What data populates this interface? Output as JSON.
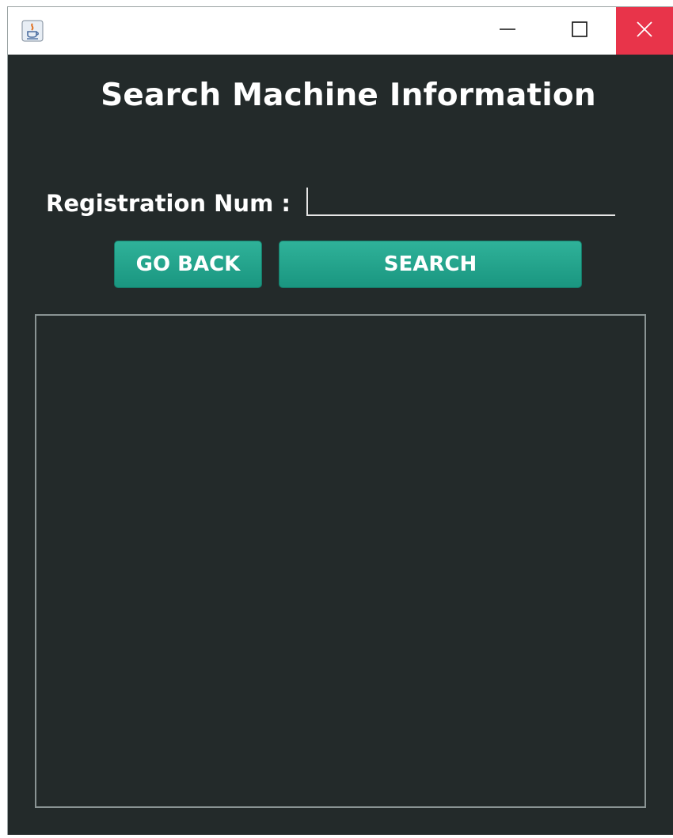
{
  "window": {
    "title": "",
    "controls": {
      "minimize_icon": "minimize-icon",
      "maximize_icon": "maximize-icon",
      "close_icon": "close-icon"
    },
    "colors": {
      "background": "#232a2a",
      "close_button": "#e8344a",
      "accent_button": "#1fa48b"
    }
  },
  "form": {
    "heading": "Search Machine Information",
    "registration_label": "Registration Num :",
    "registration_value": "",
    "registration_placeholder": ""
  },
  "buttons": {
    "go_back_label": "GO BACK",
    "search_label": "SEARCH"
  },
  "results": {
    "content": ""
  }
}
